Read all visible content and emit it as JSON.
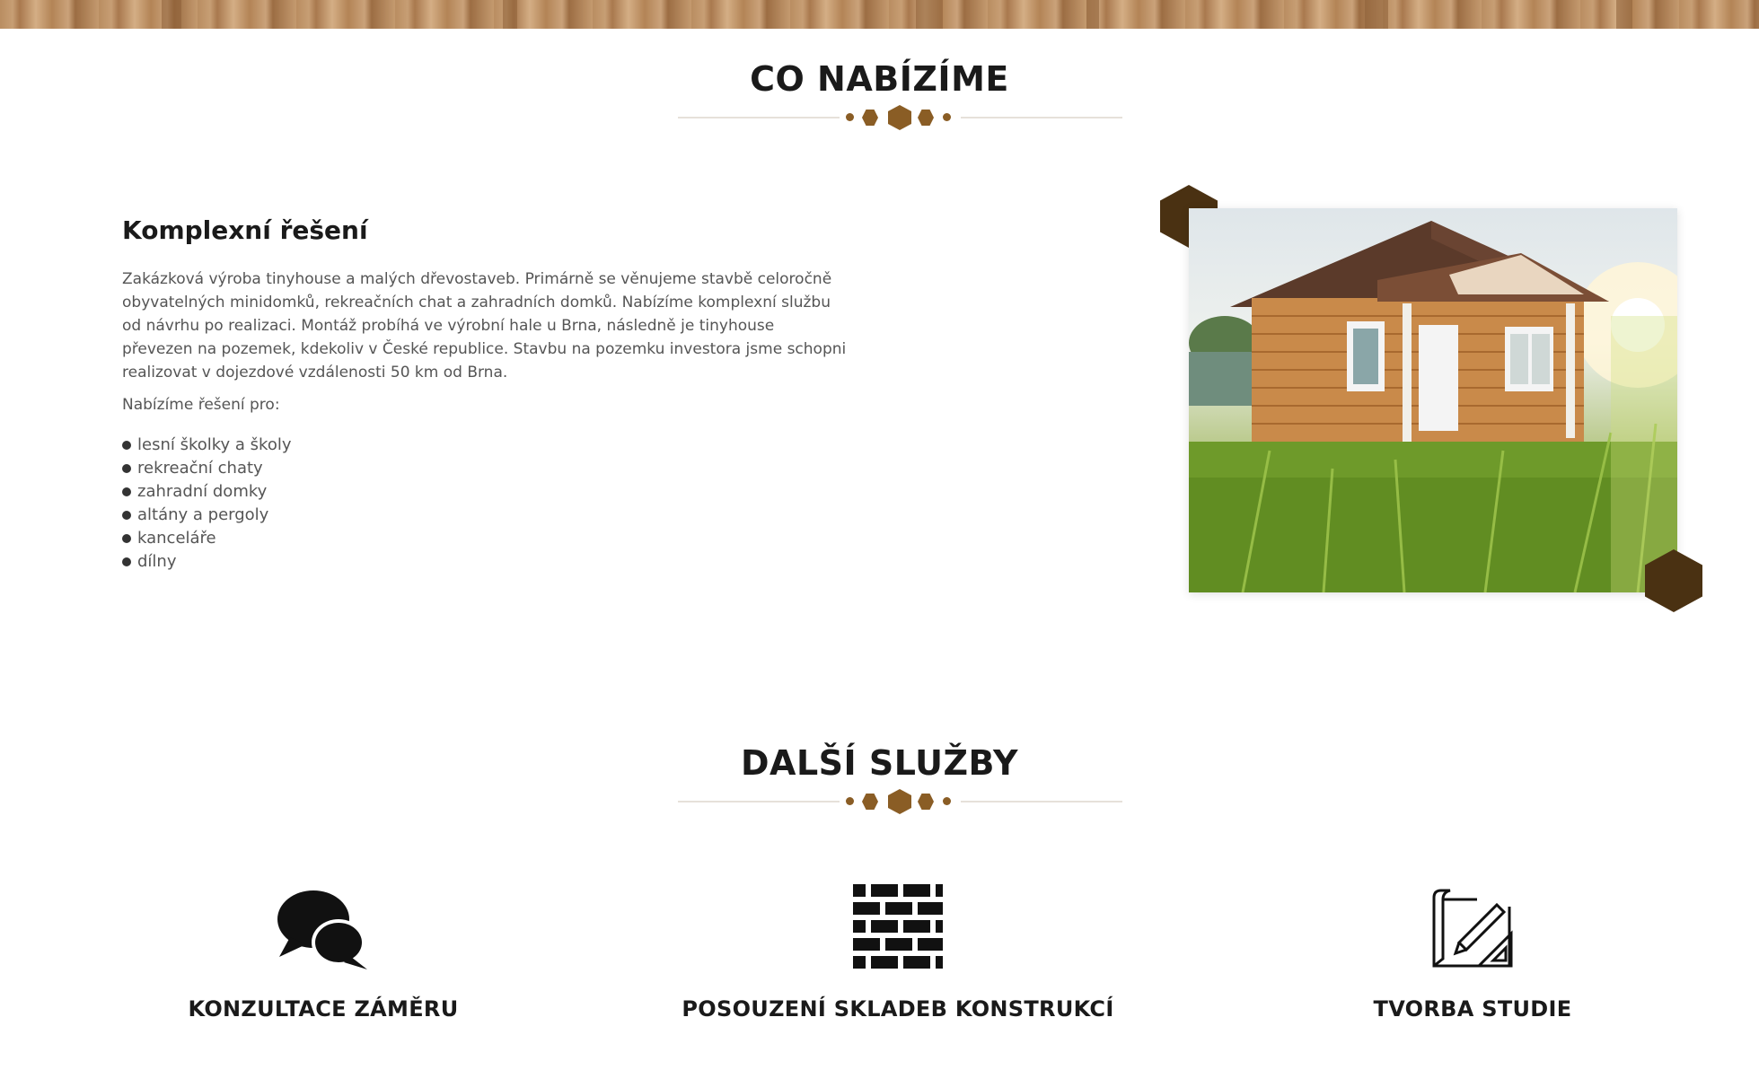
{
  "offer_section": {
    "title": "CO NABÍZÍME",
    "heading": "Komplexní řešení",
    "paragraph": "Zakázková výroba tinyhouse a malých dřevostaveb. Primárně se věnujeme stavbě celoročně obyvatelných minidomků, rekreačních chat a zahradních domků. Nabízíme komplexní službu od návrhu po realizaci. Montáž probíhá ve výrobní hale u Brna, následně je tinyhouse převezen na pozemek, kdekoliv v České republice. Stavbu na pozemku investora jsme schopni realizovat v dojezdové vzdálenosti 50 km od Brna.",
    "intro": "Nabízíme řešení pro:",
    "items": [
      "lesní školky a školy",
      "rekreační chaty",
      "zahradní domky",
      "altány a pergoly",
      "kanceláře",
      "dílny"
    ]
  },
  "services_section": {
    "title": "DALŠÍ SLUŽBY",
    "items": [
      {
        "label": "KONZULTACE ZÁMĚRU",
        "icon": "speech-bubbles-icon"
      },
      {
        "label": "POSOUZENÍ SKLADEB KONSTRUKCÍ",
        "icon": "brick-wall-icon"
      },
      {
        "label": "TVORBA STUDIE",
        "icon": "blueprint-icon"
      }
    ]
  },
  "colors": {
    "accent": "#8a5d25",
    "hex_dark": "#4a3112",
    "text_dark": "#1a1a1a",
    "text_body": "#555555"
  }
}
